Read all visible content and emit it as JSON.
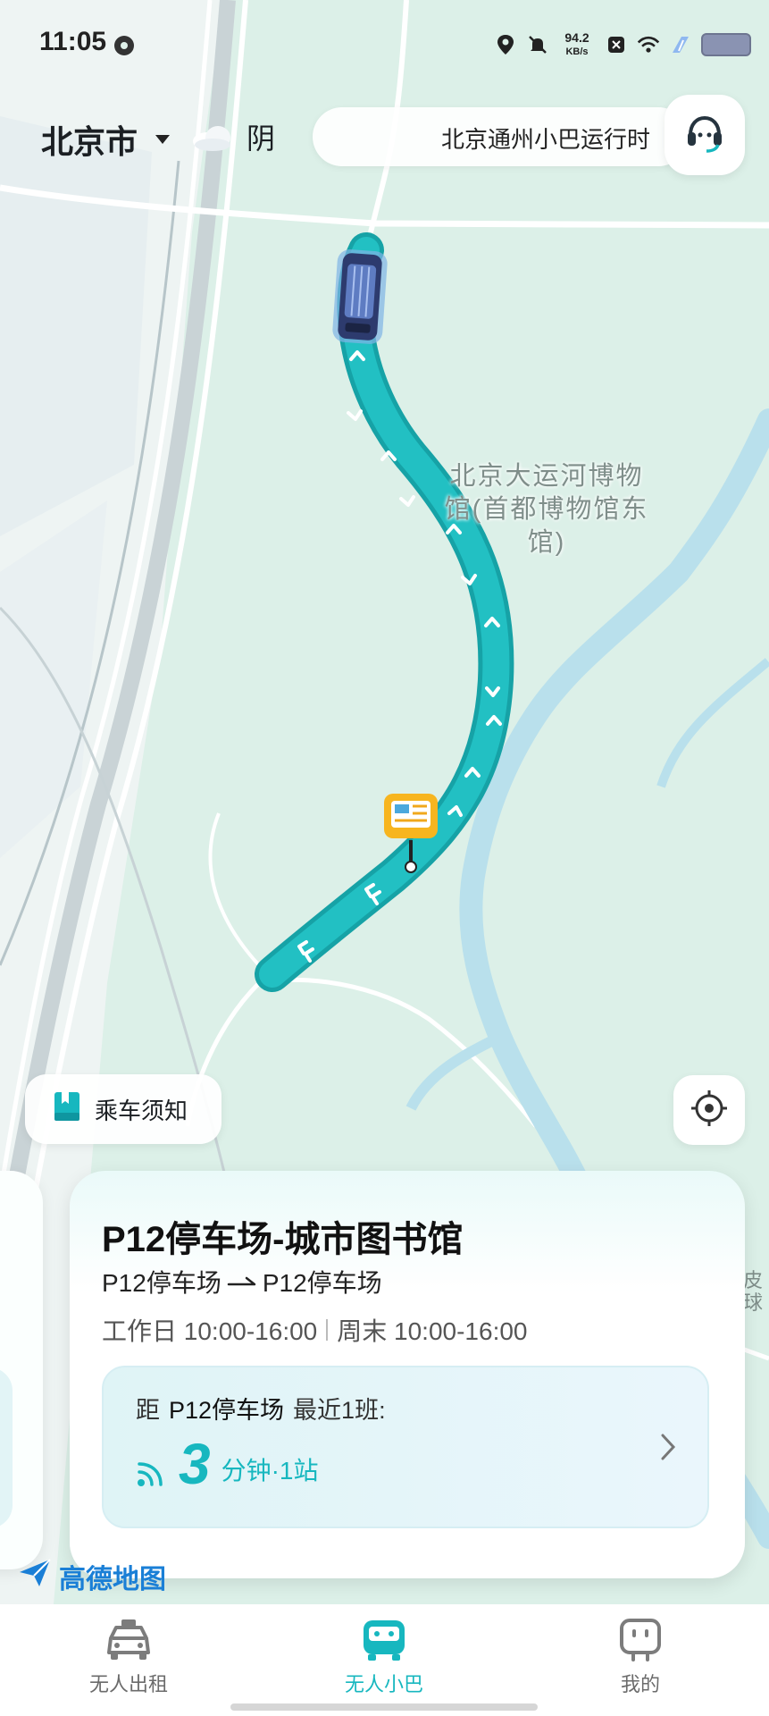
{
  "status_bar": {
    "time": "11:05",
    "net_speed": "94.2",
    "net_unit": "KB/s"
  },
  "header": {
    "city": "北京市",
    "weather": "阴",
    "notice": "北京通州小巴运行时"
  },
  "map": {
    "poi_label": "北京大运河博物馆(首都博物馆东馆)",
    "route_color": "#1fbcbf"
  },
  "chips": {
    "ride_notice": "乘车须知"
  },
  "card": {
    "title": "P12停车场-城市图书馆",
    "route_from": "P12停车场",
    "route_to": "P12停车场",
    "weekday_hours": "工作日 10:00-16:00",
    "weekend_hours": "周末 10:00-16:00",
    "next_prefix": "距",
    "next_station": "P12停车场",
    "next_suffix": "最近1班:",
    "eta_minutes": "3",
    "eta_unit": "分钟·1站"
  },
  "map_logo": "高德地图",
  "tabs": [
    {
      "label": "无人出租",
      "icon": "taxi-icon"
    },
    {
      "label": "无人小巴",
      "icon": "minibus-icon",
      "active": true
    },
    {
      "label": "我的",
      "icon": "profile-icon"
    }
  ],
  "colors": {
    "accent": "#17b7bf",
    "map_bg": "#dff1ea"
  }
}
